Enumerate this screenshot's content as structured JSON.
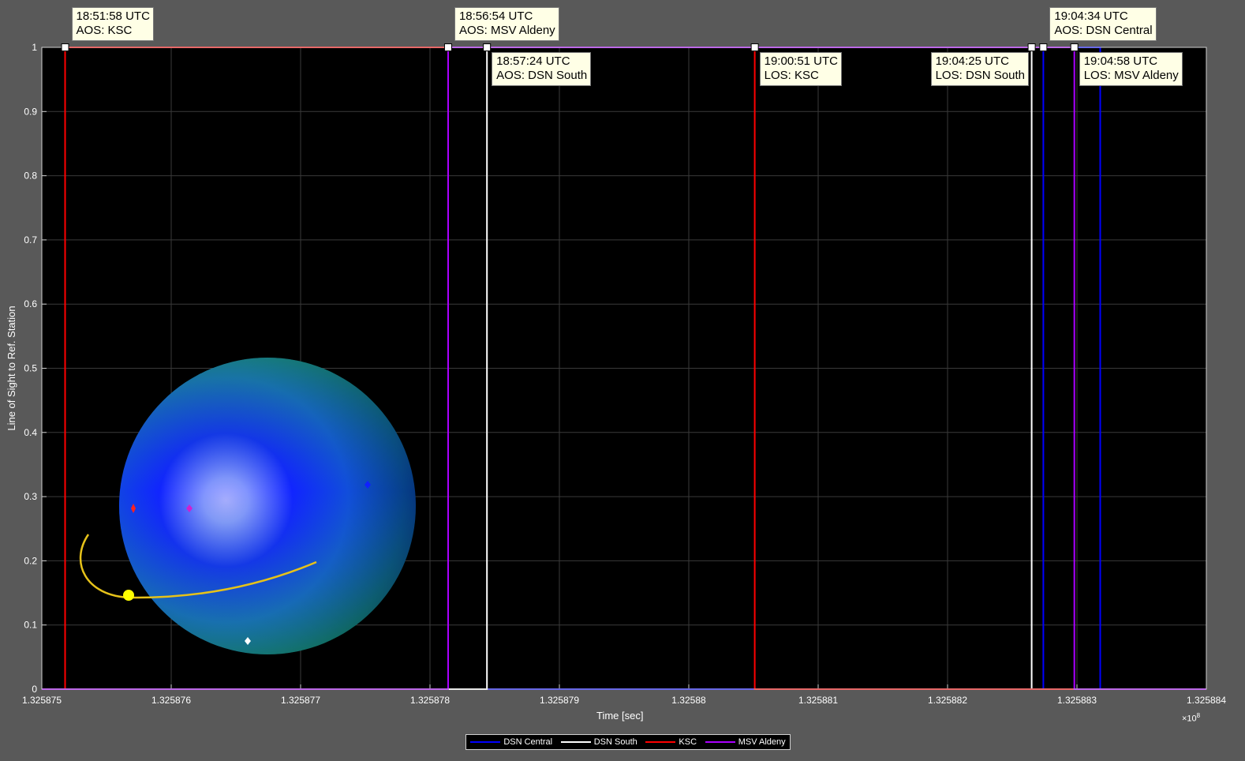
{
  "chart_data": {
    "type": "line",
    "xlabel": "Time [sec]",
    "ylabel": "Line of Sight to Ref. Station",
    "x_exponent_label": "×10",
    "x_exponent_power": "8",
    "xlim": [
      132587500,
      132588400
    ],
    "ylim": [
      0,
      1
    ],
    "x_ticks": [
      "1.325875",
      "1.325876",
      "1.325877",
      "1.325878",
      "1.325879",
      "1.32588",
      "1.325881",
      "1.325882",
      "1.325883",
      "1.325884"
    ],
    "y_ticks": [
      "0",
      "0.1",
      "0.2",
      "0.3",
      "0.4",
      "0.5",
      "0.6",
      "0.7",
      "0.8",
      "0.9",
      "1"
    ],
    "grid": true,
    "legend_position": "bottom-center",
    "series": [
      {
        "name": "DSN Central",
        "color": "#0000ff",
        "x": [
          132587500,
          132588274,
          132588274,
          132588318,
          132588318,
          132588400
        ],
        "y": [
          0,
          0,
          1,
          1,
          0,
          0
        ]
      },
      {
        "name": "DSN South",
        "color": "#ffffff",
        "x": [
          132587500,
          132587844,
          132587844,
          132588265,
          132588265,
          132588400
        ],
        "y": [
          0,
          0,
          1,
          1,
          0,
          0
        ]
      },
      {
        "name": "KSC",
        "color": "#ff0000",
        "x": [
          132587500,
          132587518,
          132587518,
          132588051,
          132588051,
          132588400
        ],
        "y": [
          0,
          0,
          1,
          1,
          0,
          0
        ]
      },
      {
        "name": "MSV Aldeny",
        "color": "#aa00ff",
        "x": [
          132587500,
          132587814,
          132587814,
          132588298,
          132588298,
          132588400
        ],
        "y": [
          0,
          0,
          1,
          1,
          0,
          0
        ]
      }
    ],
    "annotations": [
      {
        "time": "18:51:58 UTC",
        "event": "AOS: KSC",
        "x": 132587518,
        "y": 1,
        "anchor": "above-right"
      },
      {
        "time": "18:56:54 UTC",
        "event": "AOS: MSV Aldeny",
        "x": 132587814,
        "y": 1,
        "anchor": "above-right"
      },
      {
        "time": "18:57:24 UTC",
        "event": "AOS: DSN South",
        "x": 132587844,
        "y": 1,
        "anchor": "below-right"
      },
      {
        "time": "19:00:51 UTC",
        "event": "LOS: KSC",
        "x": 132588051,
        "y": 1,
        "anchor": "below-right"
      },
      {
        "time": "19:04:25 UTC",
        "event": "LOS: DSN South",
        "x": 132588265,
        "y": 1,
        "anchor": "below-left"
      },
      {
        "time": "19:04:34 UTC",
        "event": "AOS: DSN Central",
        "x": 132588274,
        "y": 1,
        "anchor": "above-right"
      },
      {
        "time": "19:04:58 UTC",
        "event": "LOS: MSV Aldeny",
        "x": 132588298,
        "y": 1,
        "anchor": "below-right"
      }
    ]
  }
}
